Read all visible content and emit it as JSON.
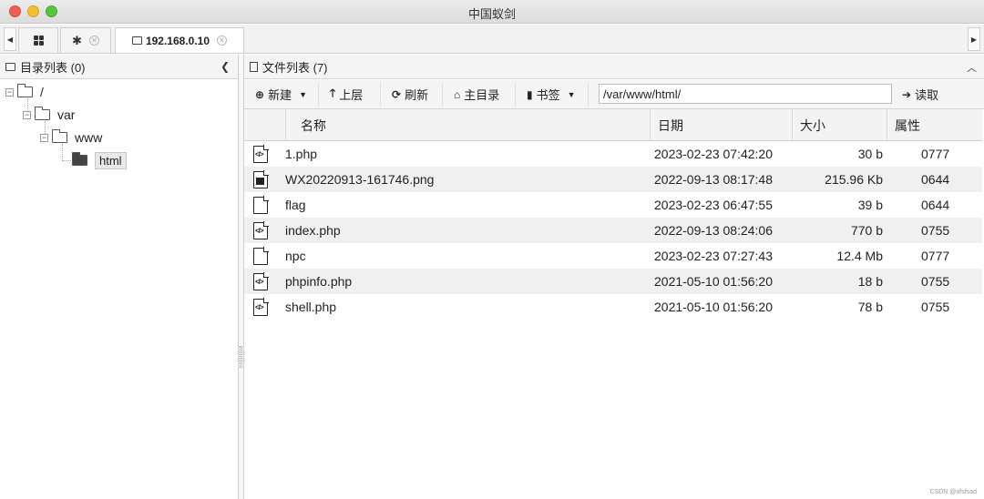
{
  "window": {
    "title": "中国蚁剑"
  },
  "tabs": [
    {
      "name": "grid-tab",
      "icon": "grid-icon"
    },
    {
      "name": "settings-tab",
      "icon": "gear-icon"
    },
    {
      "name": "host-tab",
      "icon": "folder-icon",
      "label": "192.168.0.10"
    }
  ],
  "left": {
    "header": "目录列表 (0)",
    "tree": [
      {
        "label": "/",
        "level": 0
      },
      {
        "label": "var",
        "level": 1
      },
      {
        "label": "www",
        "level": 2
      },
      {
        "label": "html",
        "level": 3,
        "selected": true
      }
    ]
  },
  "right": {
    "header": "文件列表 (7)",
    "toolbar": {
      "new_label": "新建",
      "up_label": "上层",
      "refresh_label": "刷新",
      "home_label": "主目录",
      "bookmark_label": "书签",
      "path_value": "/var/www/html/",
      "read_label": "读取"
    },
    "columns": {
      "name": "名称",
      "date": "日期",
      "size": "大小",
      "perm": "属性"
    },
    "files": [
      {
        "name": "1.php",
        "date": "2023-02-23 07:42:20",
        "size": "30 b",
        "perm": "0777",
        "icon": "code-file-icon"
      },
      {
        "name": "WX20220913-161746.png",
        "date": "2022-09-13 08:17:48",
        "size": "215.96 Kb",
        "perm": "0644",
        "icon": "image-file-icon"
      },
      {
        "name": "flag",
        "date": "2023-02-23 06:47:55",
        "size": "39 b",
        "perm": "0644",
        "icon": "file-icon"
      },
      {
        "name": "index.php",
        "date": "2022-09-13 08:24:06",
        "size": "770 b",
        "perm": "0755",
        "icon": "code-file-icon"
      },
      {
        "name": "npc",
        "date": "2023-02-23 07:27:43",
        "size": "12.4 Mb",
        "perm": "0777",
        "icon": "file-icon"
      },
      {
        "name": "phpinfo.php",
        "date": "2021-05-10 01:56:20",
        "size": "18 b",
        "perm": "0755",
        "icon": "code-file-icon"
      },
      {
        "name": "shell.php",
        "date": "2021-05-10 01:56:20",
        "size": "78 b",
        "perm": "0755",
        "icon": "code-file-icon"
      }
    ]
  },
  "watermark": "CSDN @afsfsad"
}
